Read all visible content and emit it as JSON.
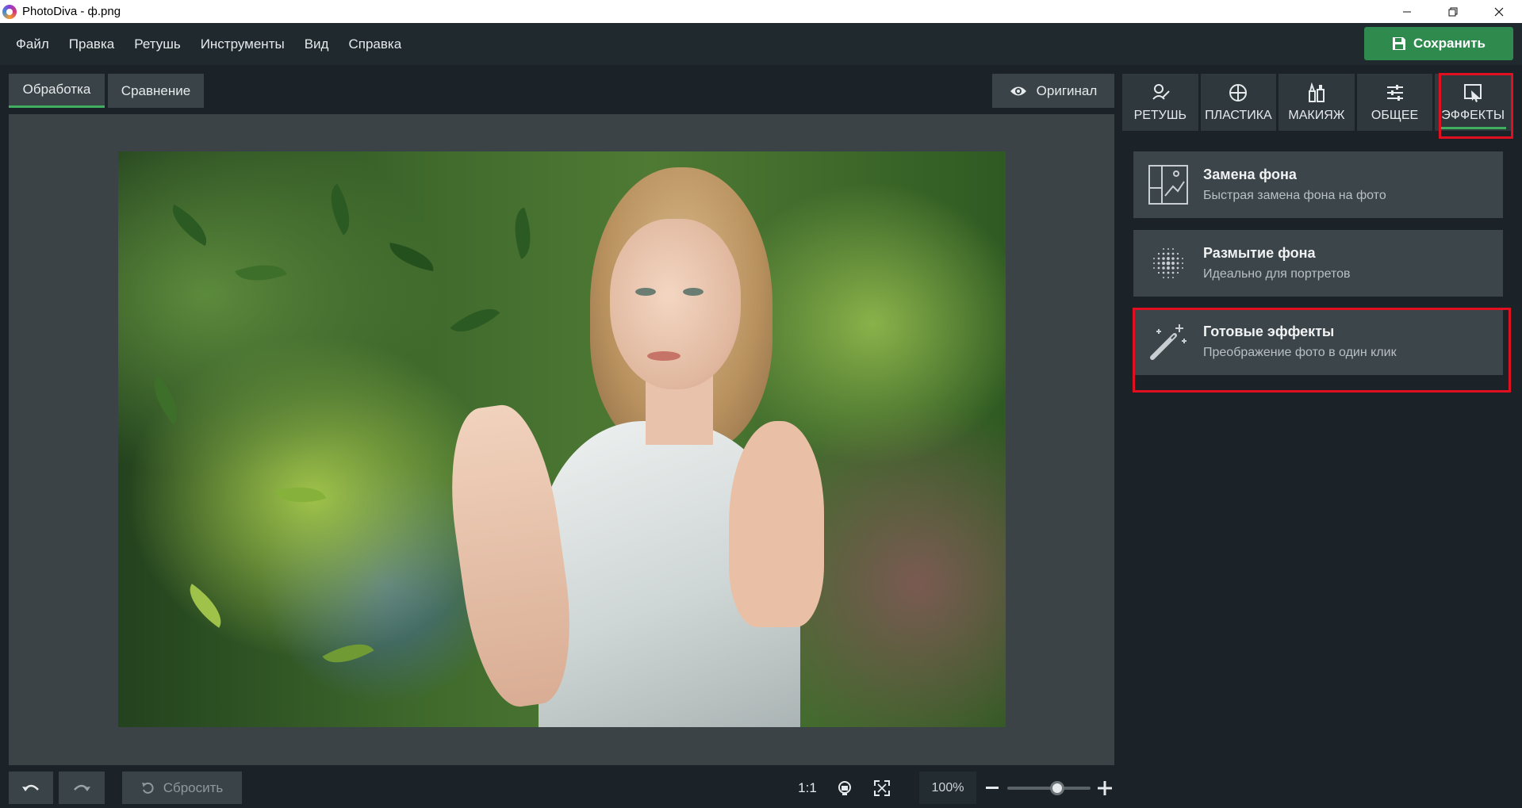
{
  "window": {
    "title": "PhotoDiva - ф.png",
    "controls": {
      "minimize": "—",
      "restore": "❐",
      "close": "✕"
    }
  },
  "menu": {
    "items": [
      "Файл",
      "Правка",
      "Ретушь",
      "Инструменты",
      "Вид",
      "Справка"
    ],
    "save_label": "Сохранить"
  },
  "view_tabs": {
    "processing": "Обработка",
    "compare": "Сравнение",
    "original": "Оригинал"
  },
  "bottom": {
    "reset_label": "Сбросить",
    "one_to_one": "1:1",
    "zoom_value": "100%",
    "zoom_minus": "—",
    "zoom_plus": "+",
    "zoom_level_fraction": 0.6
  },
  "category_tabs": {
    "items": [
      "РЕТУШЬ",
      "ПЛАСТИКА",
      "МАКИЯЖ",
      "ОБЩЕЕ",
      "ЭФФЕКТЫ"
    ],
    "active": "ЭФФЕКТЫ",
    "accent": "#3fae5e"
  },
  "effects": [
    {
      "title": "Замена фона",
      "subtitle": "Быстрая замена фона на фото"
    },
    {
      "title": "Размытие фона",
      "subtitle": "Идеально для портретов"
    },
    {
      "title": "Готовые эффекты",
      "subtitle": "Преображение фото в один клик"
    }
  ],
  "colors": {
    "save_button": "#2f8a4e",
    "highlight": "#e01020",
    "panel": "#1b2328"
  },
  "icons": {
    "undo": "undo-icon",
    "redo": "redo-icon",
    "eye": "eye-icon",
    "save": "floppy-disk-icon"
  }
}
